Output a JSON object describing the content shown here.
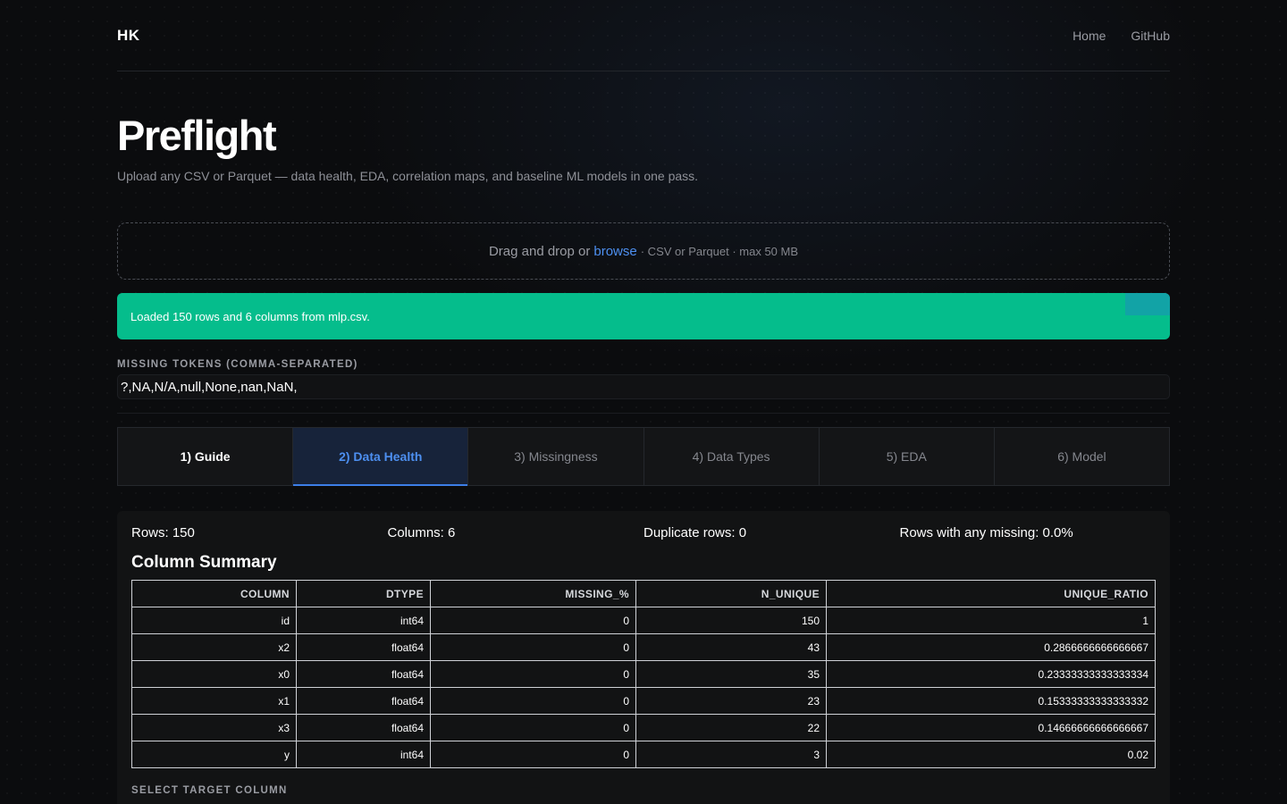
{
  "header": {
    "brand": "HK",
    "nav": [
      {
        "label": "Home"
      },
      {
        "label": "GitHub"
      }
    ]
  },
  "hero": {
    "title": "Preflight",
    "subtitle": "Upload any CSV or Parquet — data health, EDA, correlation maps, and baseline ML models in one pass."
  },
  "upload": {
    "prefix": "Drag and drop or",
    "browse_label": "browse",
    "meta": "· CSV or Parquet · max 50 MB"
  },
  "alert": {
    "message": "Loaded 150 rows and 6 columns from mlp.csv."
  },
  "missing_tokens": {
    "label": "MISSING TOKENS (COMMA-SEPARATED)",
    "value": "?,NA,N/A,null,None,nan,NaN,"
  },
  "tabs": [
    {
      "label": "1) Guide"
    },
    {
      "label": "2) Data Health"
    },
    {
      "label": "3) Missingness"
    },
    {
      "label": "4) Data Types"
    },
    {
      "label": "5) EDA"
    },
    {
      "label": "6) Model"
    }
  ],
  "stats": {
    "rows": "Rows: 150",
    "columns": "Columns: 6",
    "duplicates": "Duplicate rows: 0",
    "missing": "Rows with any missing: 0.0%"
  },
  "summary": {
    "title": "Column Summary",
    "headers": [
      "COLUMN",
      "DTYPE",
      "MISSING_%",
      "N_UNIQUE",
      "UNIQUE_RATIO"
    ],
    "rows": [
      [
        "id",
        "int64",
        "0",
        "150",
        "1"
      ],
      [
        "x2",
        "float64",
        "0",
        "43",
        "0.2866666666666667"
      ],
      [
        "x0",
        "float64",
        "0",
        "35",
        "0.23333333333333334"
      ],
      [
        "x1",
        "float64",
        "0",
        "23",
        "0.15333333333333332"
      ],
      [
        "x3",
        "float64",
        "0",
        "22",
        "0.14666666666666667"
      ],
      [
        "y",
        "int64",
        "0",
        "3",
        "0.02"
      ]
    ]
  },
  "target": {
    "label": "SELECT TARGET COLUMN"
  },
  "colors": {
    "accent": "#4d8ff0",
    "success": "#05bd8c",
    "background": "#0b0c0e"
  }
}
